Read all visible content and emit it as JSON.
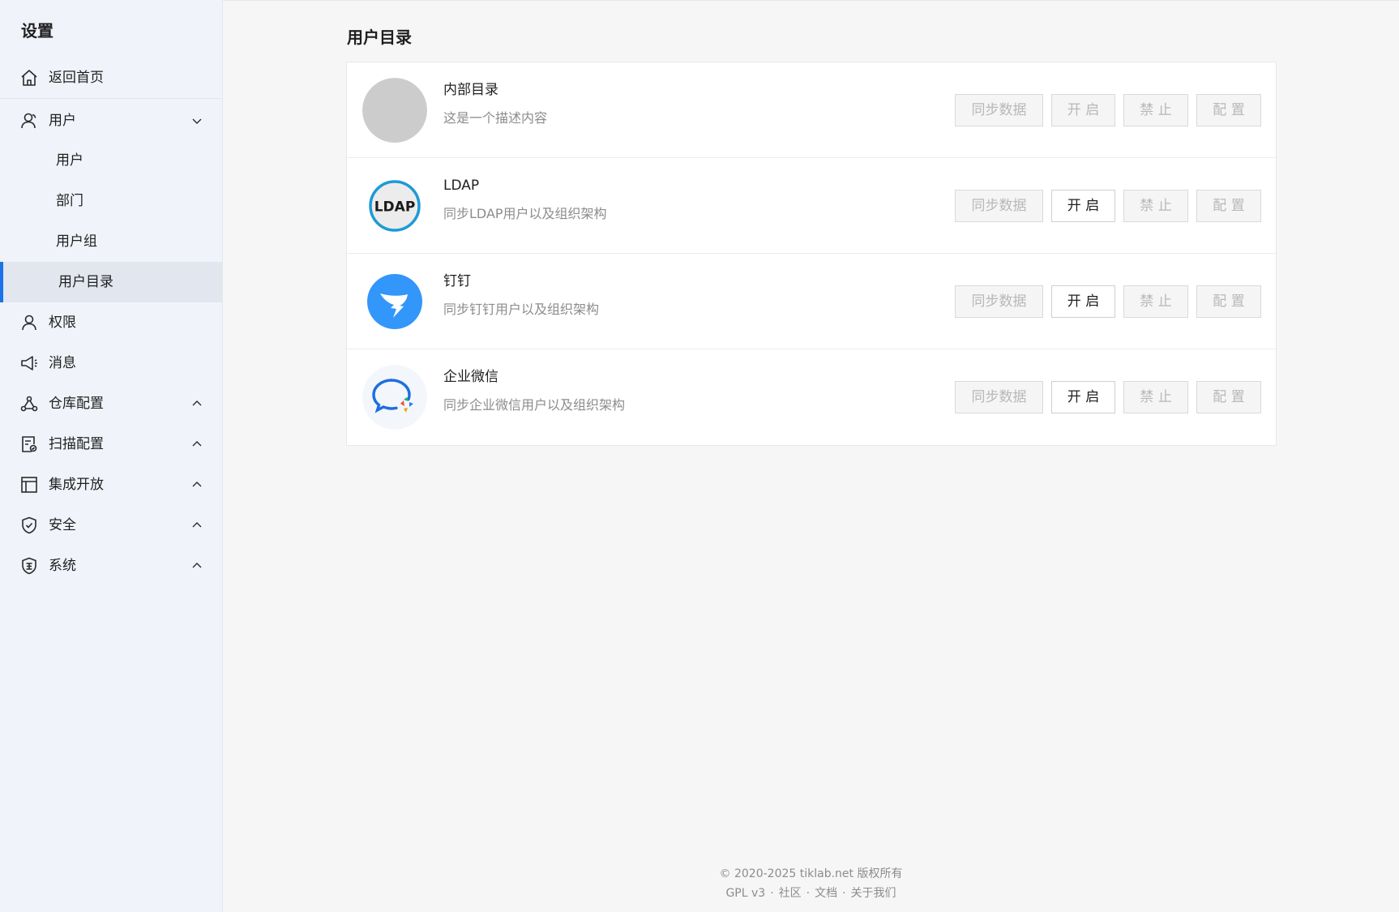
{
  "sidebar": {
    "title": "设置",
    "home": {
      "label": "返回首页",
      "icon": "home-icon"
    },
    "user_group": {
      "label": "用户",
      "icon": "user-icon",
      "expanded": true
    },
    "user_subitems": [
      {
        "label": "用户",
        "active": false
      },
      {
        "label": "部门",
        "active": false
      },
      {
        "label": "用户组",
        "active": false
      },
      {
        "label": "用户目录",
        "active": true
      }
    ],
    "items": [
      {
        "label": "权限",
        "icon": "permission-icon",
        "chevron": false
      },
      {
        "label": "消息",
        "icon": "megaphone-icon",
        "chevron": false
      },
      {
        "label": "仓库配置",
        "icon": "repository-icon",
        "chevron": true
      },
      {
        "label": "扫描配置",
        "icon": "scan-config-icon",
        "chevron": true
      },
      {
        "label": "集成开放",
        "icon": "integration-icon",
        "chevron": true
      },
      {
        "label": "安全",
        "icon": "shield-icon",
        "chevron": true
      },
      {
        "label": "系统",
        "icon": "system-badge-icon",
        "chevron": true
      }
    ]
  },
  "main": {
    "title": "用户目录",
    "directories": [
      {
        "name": "内部目录",
        "desc": "这是一个描述内容",
        "logo": "placeholder-avatar-icon",
        "buttons": {
          "sync": "同步数据",
          "open": "开 启",
          "ban": "禁 止",
          "config": "配 置"
        },
        "open_enabled": false
      },
      {
        "name": "LDAP",
        "desc": "同步LDAP用户以及组织架构",
        "logo": "ldap-logo-icon",
        "logo_text": "LDAP",
        "buttons": {
          "sync": "同步数据",
          "open": "开 启",
          "ban": "禁 止",
          "config": "配 置"
        },
        "open_enabled": true
      },
      {
        "name": "钉钉",
        "desc": "同步钉钉用户以及组织架构",
        "logo": "dingtalk-logo-icon",
        "buttons": {
          "sync": "同步数据",
          "open": "开 启",
          "ban": "禁 止",
          "config": "配 置"
        },
        "open_enabled": true
      },
      {
        "name": "企业微信",
        "desc": "同步企业微信用户以及组织架构",
        "logo": "wecom-logo-icon",
        "buttons": {
          "sync": "同步数据",
          "open": "开 启",
          "ban": "禁 止",
          "config": "配 置"
        },
        "open_enabled": true
      }
    ]
  },
  "footer": {
    "copyright": "© 2020-2025 tiklab.net 版权所有",
    "links": [
      "GPL v3",
      "社区",
      "文档",
      "关于我们"
    ],
    "separator": "·"
  },
  "colors": {
    "accent": "#1a73e8",
    "sidebar_bg": "#f0f3fa",
    "active_item_bg": "#e2e6ee",
    "dingtalk_blue": "#3296fa",
    "ldap_ring": "#1e9ad6"
  }
}
